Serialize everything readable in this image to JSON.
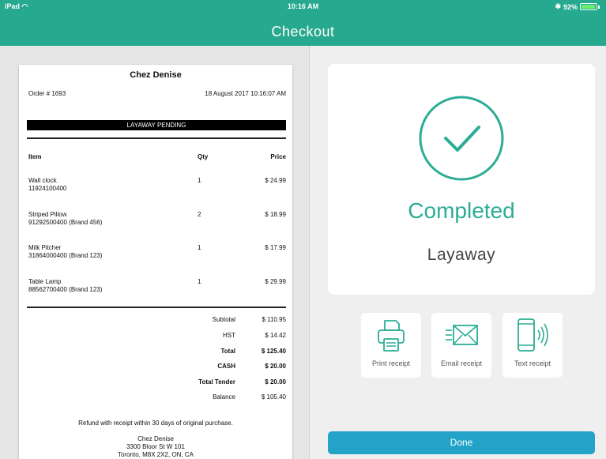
{
  "status_bar": {
    "device": "iPad",
    "time": "10:16 AM",
    "battery": "92%",
    "battery_level": 0.92
  },
  "header": {
    "title": "Checkout"
  },
  "receipt": {
    "store_name": "Chez Denise",
    "order_number": "Order # 1693",
    "date": "18 August 2017 10:16:07 AM",
    "banner": "LAYAWAY PENDING",
    "columns": {
      "item": "Item",
      "qty": "Qty",
      "price": "Price"
    },
    "items": [
      {
        "name": "Wall clock",
        "sku": "11924100400",
        "qty": "1",
        "price": "$ 24.99"
      },
      {
        "name": "Striped Pillow",
        "sku": "91292500400 (Brand 456)",
        "qty": "2",
        "price": "$ 18.99"
      },
      {
        "name": "Milk Pitcher",
        "sku": "31864000400 (Brand 123)",
        "qty": "1",
        "price": "$ 17.99"
      },
      {
        "name": "Table Lamp",
        "sku": "88562700400 (Brand 123)",
        "qty": "1",
        "price": "$ 29.99"
      }
    ],
    "totals": [
      {
        "label": "Subtotal",
        "value": "$ 110.95",
        "bold": false
      },
      {
        "label": "HST",
        "value": "$ 14.42",
        "bold": false
      },
      {
        "label": "Total",
        "value": "$ 125.40",
        "bold": true
      },
      {
        "label": "CASH",
        "value": "$ 20.00",
        "bold": true
      },
      {
        "label": "Total Tender",
        "value": "$ 20.00",
        "bold": true
      },
      {
        "label": "Balance",
        "value": "$ 105.40",
        "bold": false
      }
    ],
    "policy": "Refund with receipt within 30 days of original purchase.",
    "footer_name": "Chez Denise",
    "footer_address1": "3300 Bloor St W 101",
    "footer_address2": "Toronto, M8X 2X2, ON, CA"
  },
  "result": {
    "status": "Completed",
    "type": "Layaway"
  },
  "receipt_options": [
    {
      "label": "Print receipt",
      "icon": "printer-icon"
    },
    {
      "label": "Email receipt",
      "icon": "envelope-icon"
    },
    {
      "label": "Text receipt",
      "icon": "phone-icon"
    }
  ],
  "done_button": {
    "label": "Done"
  },
  "colors": {
    "brand": "#27a98f",
    "accent": "#2bad95",
    "done": "#22a3c7"
  }
}
